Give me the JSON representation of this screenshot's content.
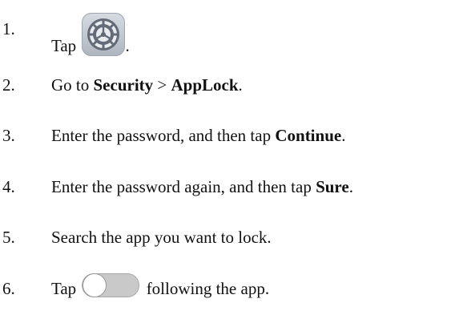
{
  "steps": [
    {
      "number": "1.",
      "before": "Tap ",
      "after": "."
    },
    {
      "number": "2.",
      "before": "Go to ",
      "bold1": "Security",
      "mid": " > ",
      "bold2": "AppLock",
      "after": "."
    },
    {
      "number": "3.",
      "before": "Enter the password, and then tap ",
      "bold": "Continue",
      "after": "."
    },
    {
      "number": "4.",
      "before": "Enter the password again, and then tap ",
      "bold": "Sure",
      "after": "."
    },
    {
      "number": "5.",
      "text": "Search the app you want to lock."
    },
    {
      "number": "6.",
      "before": "Tap ",
      "after": " following the app."
    }
  ],
  "icons": {
    "step1": "settings-gear-icon",
    "step6": "toggle-switch-off-icon"
  }
}
